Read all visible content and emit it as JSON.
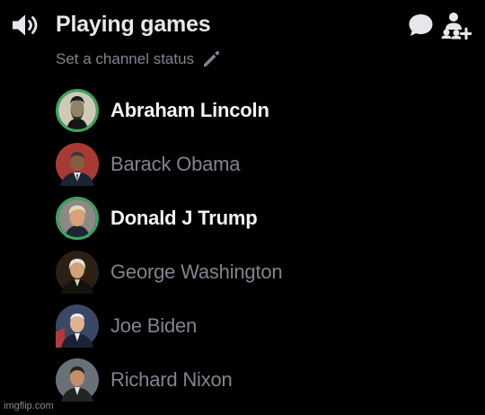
{
  "channel": {
    "name": "Playing games",
    "status_placeholder": "Set a channel status",
    "speaker_icon": "speaker-icon",
    "chat_icon": "chat-bubble-icon",
    "invite_icon": "add-members-icon",
    "edit_icon": "pencil-icon"
  },
  "members": [
    {
      "name": "Abraham Lincoln",
      "speaking": true
    },
    {
      "name": "Barack Obama",
      "speaking": false
    },
    {
      "name": "Donald J Trump",
      "speaking": true
    },
    {
      "name": "George Washington",
      "speaking": false
    },
    {
      "name": "Joe Biden",
      "speaking": false
    },
    {
      "name": "Richard Nixon",
      "speaking": false
    }
  ],
  "watermark": "imgflip.com",
  "colors": {
    "background": "#000000",
    "speaking_ring": "#3ba55d",
    "active_name": "#f2f3f5",
    "muted_text": "#80848e",
    "header_text": "#e6e7ea"
  }
}
